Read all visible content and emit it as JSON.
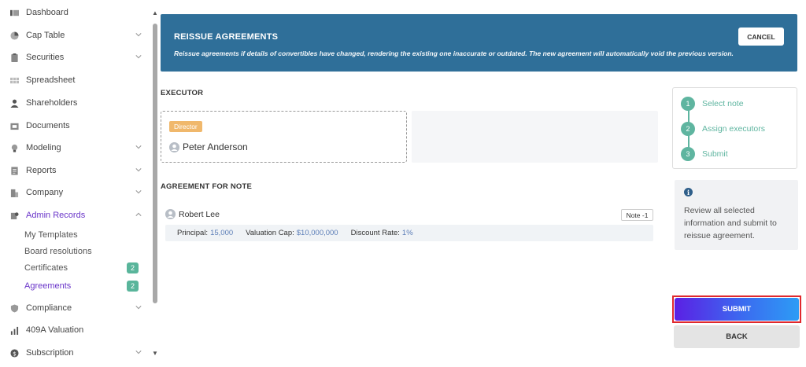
{
  "sidebar": {
    "items": [
      {
        "label": "Dashboard",
        "icon": "dashboard-icon"
      },
      {
        "label": "Cap Table",
        "icon": "pie-chart-icon"
      },
      {
        "label": "Securities",
        "icon": "clipboard-icon"
      },
      {
        "label": "Spreadsheet",
        "icon": "grid-icon"
      },
      {
        "label": "Shareholders",
        "icon": "user-icon"
      },
      {
        "label": "Documents",
        "icon": "folder-icon"
      },
      {
        "label": "Modeling",
        "icon": "lightbulb-icon"
      },
      {
        "label": "Reports",
        "icon": "report-icon"
      },
      {
        "label": "Company",
        "icon": "building-icon"
      },
      {
        "label": "Admin Records",
        "icon": "admin-icon"
      },
      {
        "label": "Compliance",
        "icon": "shield-icon"
      },
      {
        "label": "409A Valuation",
        "icon": "bar-chart-icon"
      },
      {
        "label": "Subscription",
        "icon": "dollar-icon"
      }
    ],
    "admin_sub": [
      {
        "label": "My Templates"
      },
      {
        "label": "Board resolutions"
      },
      {
        "label": "Certificates",
        "badge": "2"
      },
      {
        "label": "Agreements",
        "badge": "2"
      }
    ]
  },
  "banner": {
    "title": "REISSUE AGREEMENTS",
    "description": "Reissue agreements if details of convertibles have changed, rendering the existing one inaccurate or outdated. The new agreement will automatically void the previous version.",
    "cancel_label": "CANCEL"
  },
  "executor": {
    "section_title": "EXECUTOR",
    "role": "Director",
    "name": "Peter Anderson"
  },
  "agreement": {
    "section_title": "AGREEMENT FOR NOTE",
    "holder": "Robert Lee",
    "note_label": "Note -1",
    "principal_label": "Principal:",
    "principal_value": "15,000",
    "valuation_label": "Valuation Cap:",
    "valuation_value": "$10,000,000",
    "discount_label": "Discount Rate:",
    "discount_value": "1%"
  },
  "steps": [
    {
      "num": "1",
      "label": "Select note"
    },
    {
      "num": "2",
      "label": "Assign executors"
    },
    {
      "num": "3",
      "label": "Submit"
    }
  ],
  "info": {
    "text": "Review all selected information and submit to reissue agreement."
  },
  "actions": {
    "submit_label": "SUBMIT",
    "back_label": "BACK"
  },
  "colors": {
    "accent": "#6a35c9",
    "banner": "#2f6f99",
    "step": "#5fb5a0",
    "badge": "#59b59b",
    "highlight": "#e0282d"
  }
}
